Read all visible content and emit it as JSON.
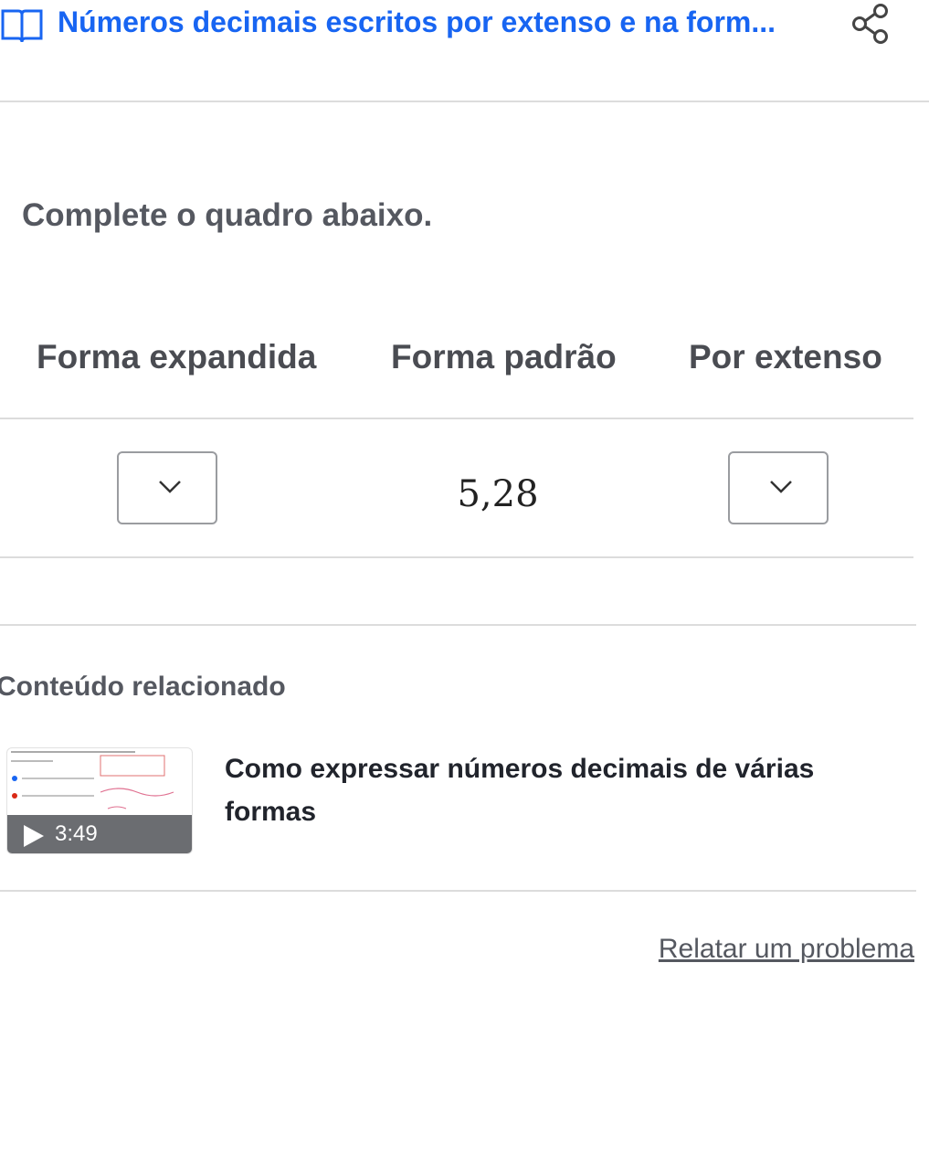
{
  "header": {
    "title": "Números decimais escritos por extenso e na form...",
    "book_icon": "book-open-icon",
    "share_icon": "share-icon"
  },
  "exercise": {
    "prompt": "Complete o quadro abaixo.",
    "columns": [
      "Forma expandida",
      "Forma padrão",
      "Por extenso"
    ],
    "standard_form_value": "5,28",
    "dropdown_icon": "chevron-down-icon"
  },
  "related": {
    "heading": "Conteúdo relacionado",
    "video": {
      "title": "Como expressar números decimais de várias formas",
      "duration": "3:49",
      "play_icon": "play-icon"
    }
  },
  "footer": {
    "report_link": "Relatar um problema"
  },
  "colors": {
    "accent": "#1865f2",
    "heading_gray": "#555860",
    "rule": "#dcdcdc"
  }
}
